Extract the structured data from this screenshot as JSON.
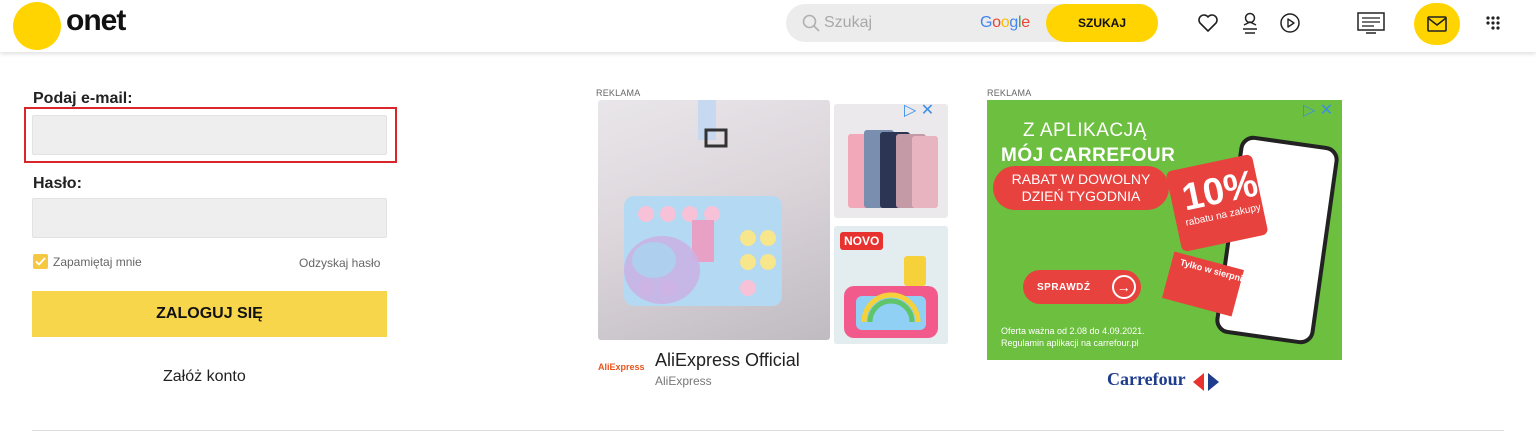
{
  "header": {
    "logo": "onet",
    "search_placeholder": "Szukaj",
    "google": "Google",
    "search_button": "SZUKAJ",
    "icons": [
      "heart-icon",
      "horoscope-icon",
      "play-icon",
      "tv-program-icon",
      "mail-icon",
      "apps-grid-icon"
    ]
  },
  "login": {
    "email_label": "Podaj e-mail:",
    "email_value": "",
    "password_label": "Hasło:",
    "password_value": "",
    "remember": "Zapamiętaj mnie",
    "remember_checked": true,
    "recover": "Odzyskaj hasło",
    "login_button": "ZALOGUJ SIĘ",
    "create_account": "Załóż konto"
  },
  "ads": {
    "ad1": {
      "label": "REKLAMA",
      "badge": "NOVO",
      "brand_logo": "AliExpress",
      "title": "AliExpress Official",
      "subtitle": "AliExpress"
    },
    "ad2": {
      "label": "REKLAMA",
      "line1": "Z APLIKACJĄ",
      "line2": "MÓJ CARREFOUR",
      "banner": "RABAT W DOWOLNY DZIEŃ TYGODNIA",
      "percent": "10%",
      "percent_sub": "rabatu na zakupy",
      "cta": "SPRAWDŹ",
      "tab": "Tylko w sierpniu",
      "small1": "Oferta ważna od 2.08 do 4.09.2021.",
      "small2": "Regulamin aplikacji na carrefour.pl",
      "brand": "Carrefour"
    }
  },
  "colors": {
    "accent": "#ffd400",
    "login_button": "#f7d64c",
    "highlight": "#d9262b",
    "carrefour_green": "#6cbf3f",
    "carrefour_red": "#e8423f"
  }
}
